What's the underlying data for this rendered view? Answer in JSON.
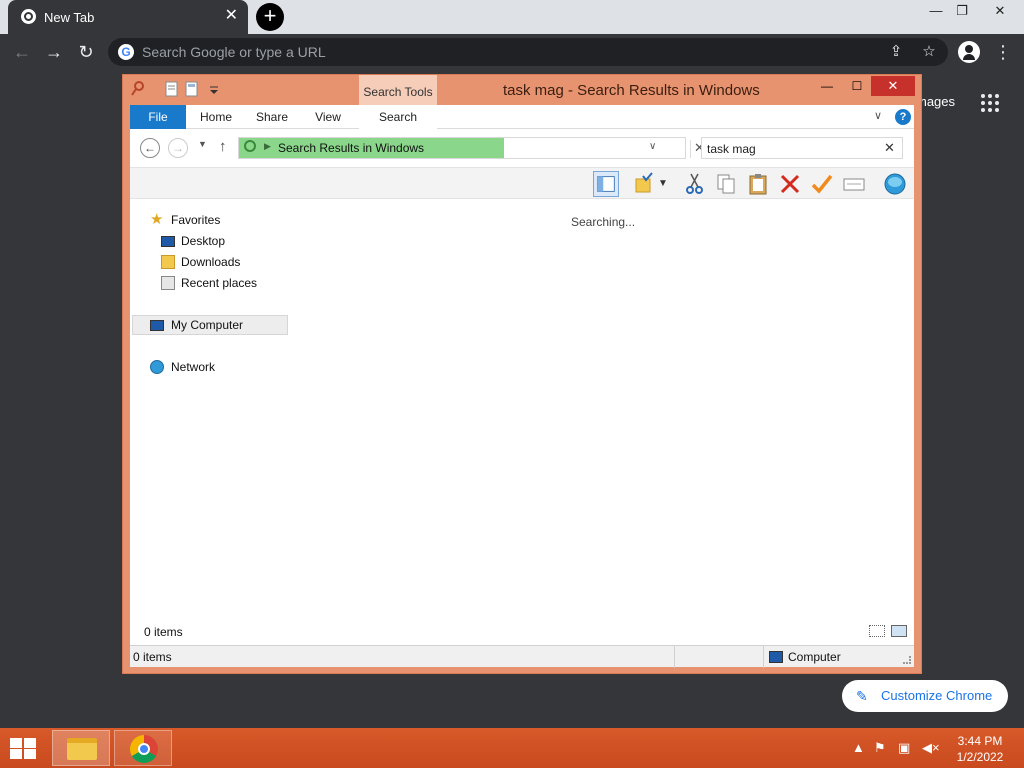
{
  "browser": {
    "tab_title": "New Tab",
    "tab_close": "✕",
    "new_tab": "+",
    "omnibox_placeholder": "Search Google or type a URL",
    "ntp_images_link": "mages",
    "customize_label": "Customize Chrome",
    "window_controls": {
      "minimize": "—",
      "restore": "❐",
      "close": "✕"
    }
  },
  "explorer": {
    "title": "task mag - Search Results in Windows",
    "ribbon": {
      "contextual_group": "Search Tools",
      "tabs": [
        "File",
        "Home",
        "Share",
        "View",
        "Search"
      ],
      "help": "?"
    },
    "address": {
      "location": "Search Results in Windows"
    },
    "search": {
      "value": "task mag"
    },
    "nav_pane": {
      "favorites": "Favorites",
      "favorites_items": [
        "Desktop",
        "Downloads",
        "Recent places"
      ],
      "computer": "My Computer",
      "network": "Network"
    },
    "content": {
      "status": "Searching..."
    },
    "item_count": "0 items",
    "statusbar": {
      "count": "0 items",
      "location": "Computer"
    },
    "colors": {
      "accent_file_tab": "#1979ca",
      "frame": "#e8936f",
      "close": "#c7312b",
      "address_progress": "#8ad68b"
    }
  },
  "taskbar": {
    "time": "3:44 PM",
    "date": "1/2/2022",
    "color": "#d85a2a"
  }
}
